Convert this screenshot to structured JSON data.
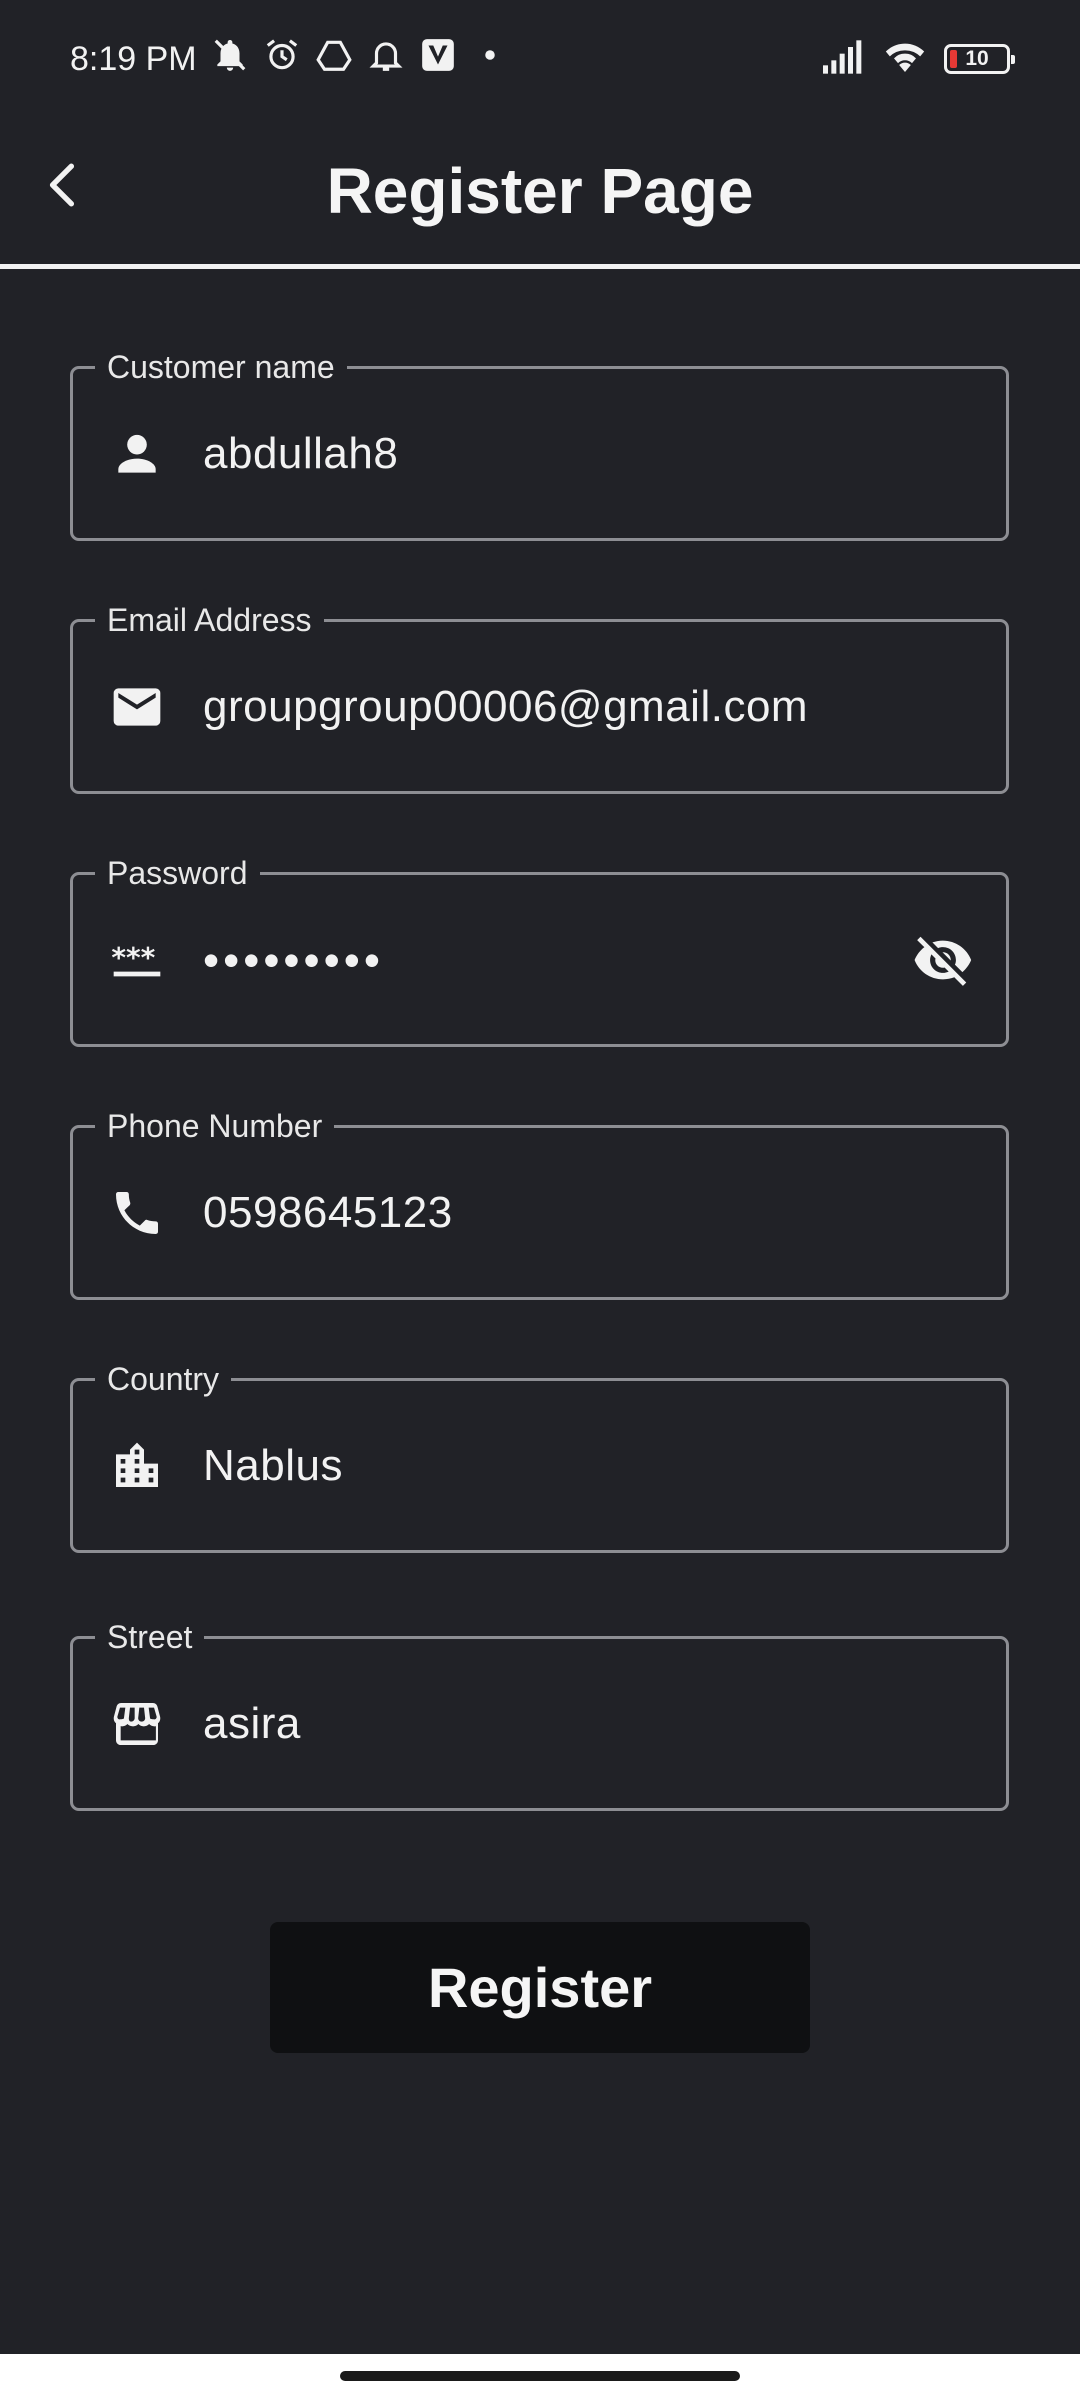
{
  "status_bar": {
    "time": "8:19 PM",
    "battery_level": "10",
    "icons": [
      "muted-bell-icon",
      "alarm-icon",
      "drive-icon",
      "notification-bell-icon",
      "v-app-icon",
      "dot-icon",
      "signal-icon",
      "wifi-icon",
      "battery-icon"
    ]
  },
  "app_bar": {
    "title": "Register Page"
  },
  "form": {
    "customer_name": {
      "label": "Customer name",
      "value": "abdullah8",
      "icon": "person-icon"
    },
    "email": {
      "label": "Email Address",
      "value": "groupgroup00006@gmail.com",
      "icon": "email-icon"
    },
    "password": {
      "label": "Password",
      "value": "•••••••••",
      "icon": "password-icon",
      "toggle_icon": "visibility-off-icon"
    },
    "phone": {
      "label": "Phone Number",
      "value": "0598645123",
      "icon": "phone-icon"
    },
    "country": {
      "label": "Country",
      "value": "Nablus",
      "icon": "city-icon"
    },
    "street": {
      "label": "Street",
      "value": "asira",
      "icon": "store-icon"
    }
  },
  "register_button": {
    "label": "Register"
  },
  "colors": {
    "background": "#212227",
    "button": "#0f1012",
    "outline": "#8d8e93",
    "text": "#f2f2f2"
  }
}
